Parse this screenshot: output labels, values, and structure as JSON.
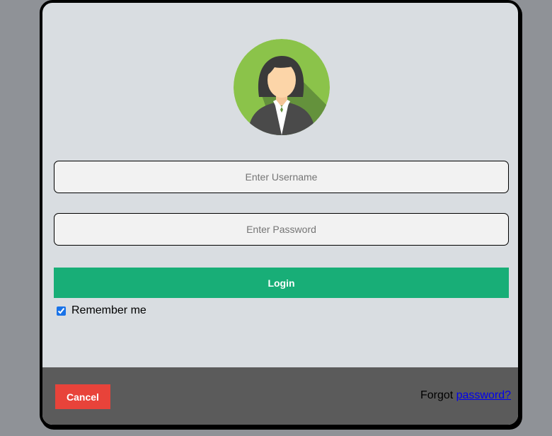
{
  "avatar": {
    "icon": "female-user-avatar-icon",
    "colors": {
      "background": "#8bc34a",
      "shadow": "#5d8a3a",
      "hair": "#3a3a3a",
      "skin": "#fcd5a8",
      "jacket": "#4a4a4a",
      "shirt": "#ffffff"
    }
  },
  "form": {
    "username_placeholder": "Enter Username",
    "username_value": "",
    "password_placeholder": "Enter Password",
    "password_value": "",
    "login_label": "Login",
    "remember_label": "Remember me",
    "remember_checked": true
  },
  "footer": {
    "cancel_label": "Cancel",
    "forgot_prefix": "Forgot ",
    "forgot_link": "password?"
  },
  "colors": {
    "login_button": "#18ae77",
    "cancel_button": "#e8433a",
    "modal_background": "#d9dde1",
    "footer_background": "#5b5b5b",
    "page_background": "#8f9297"
  }
}
